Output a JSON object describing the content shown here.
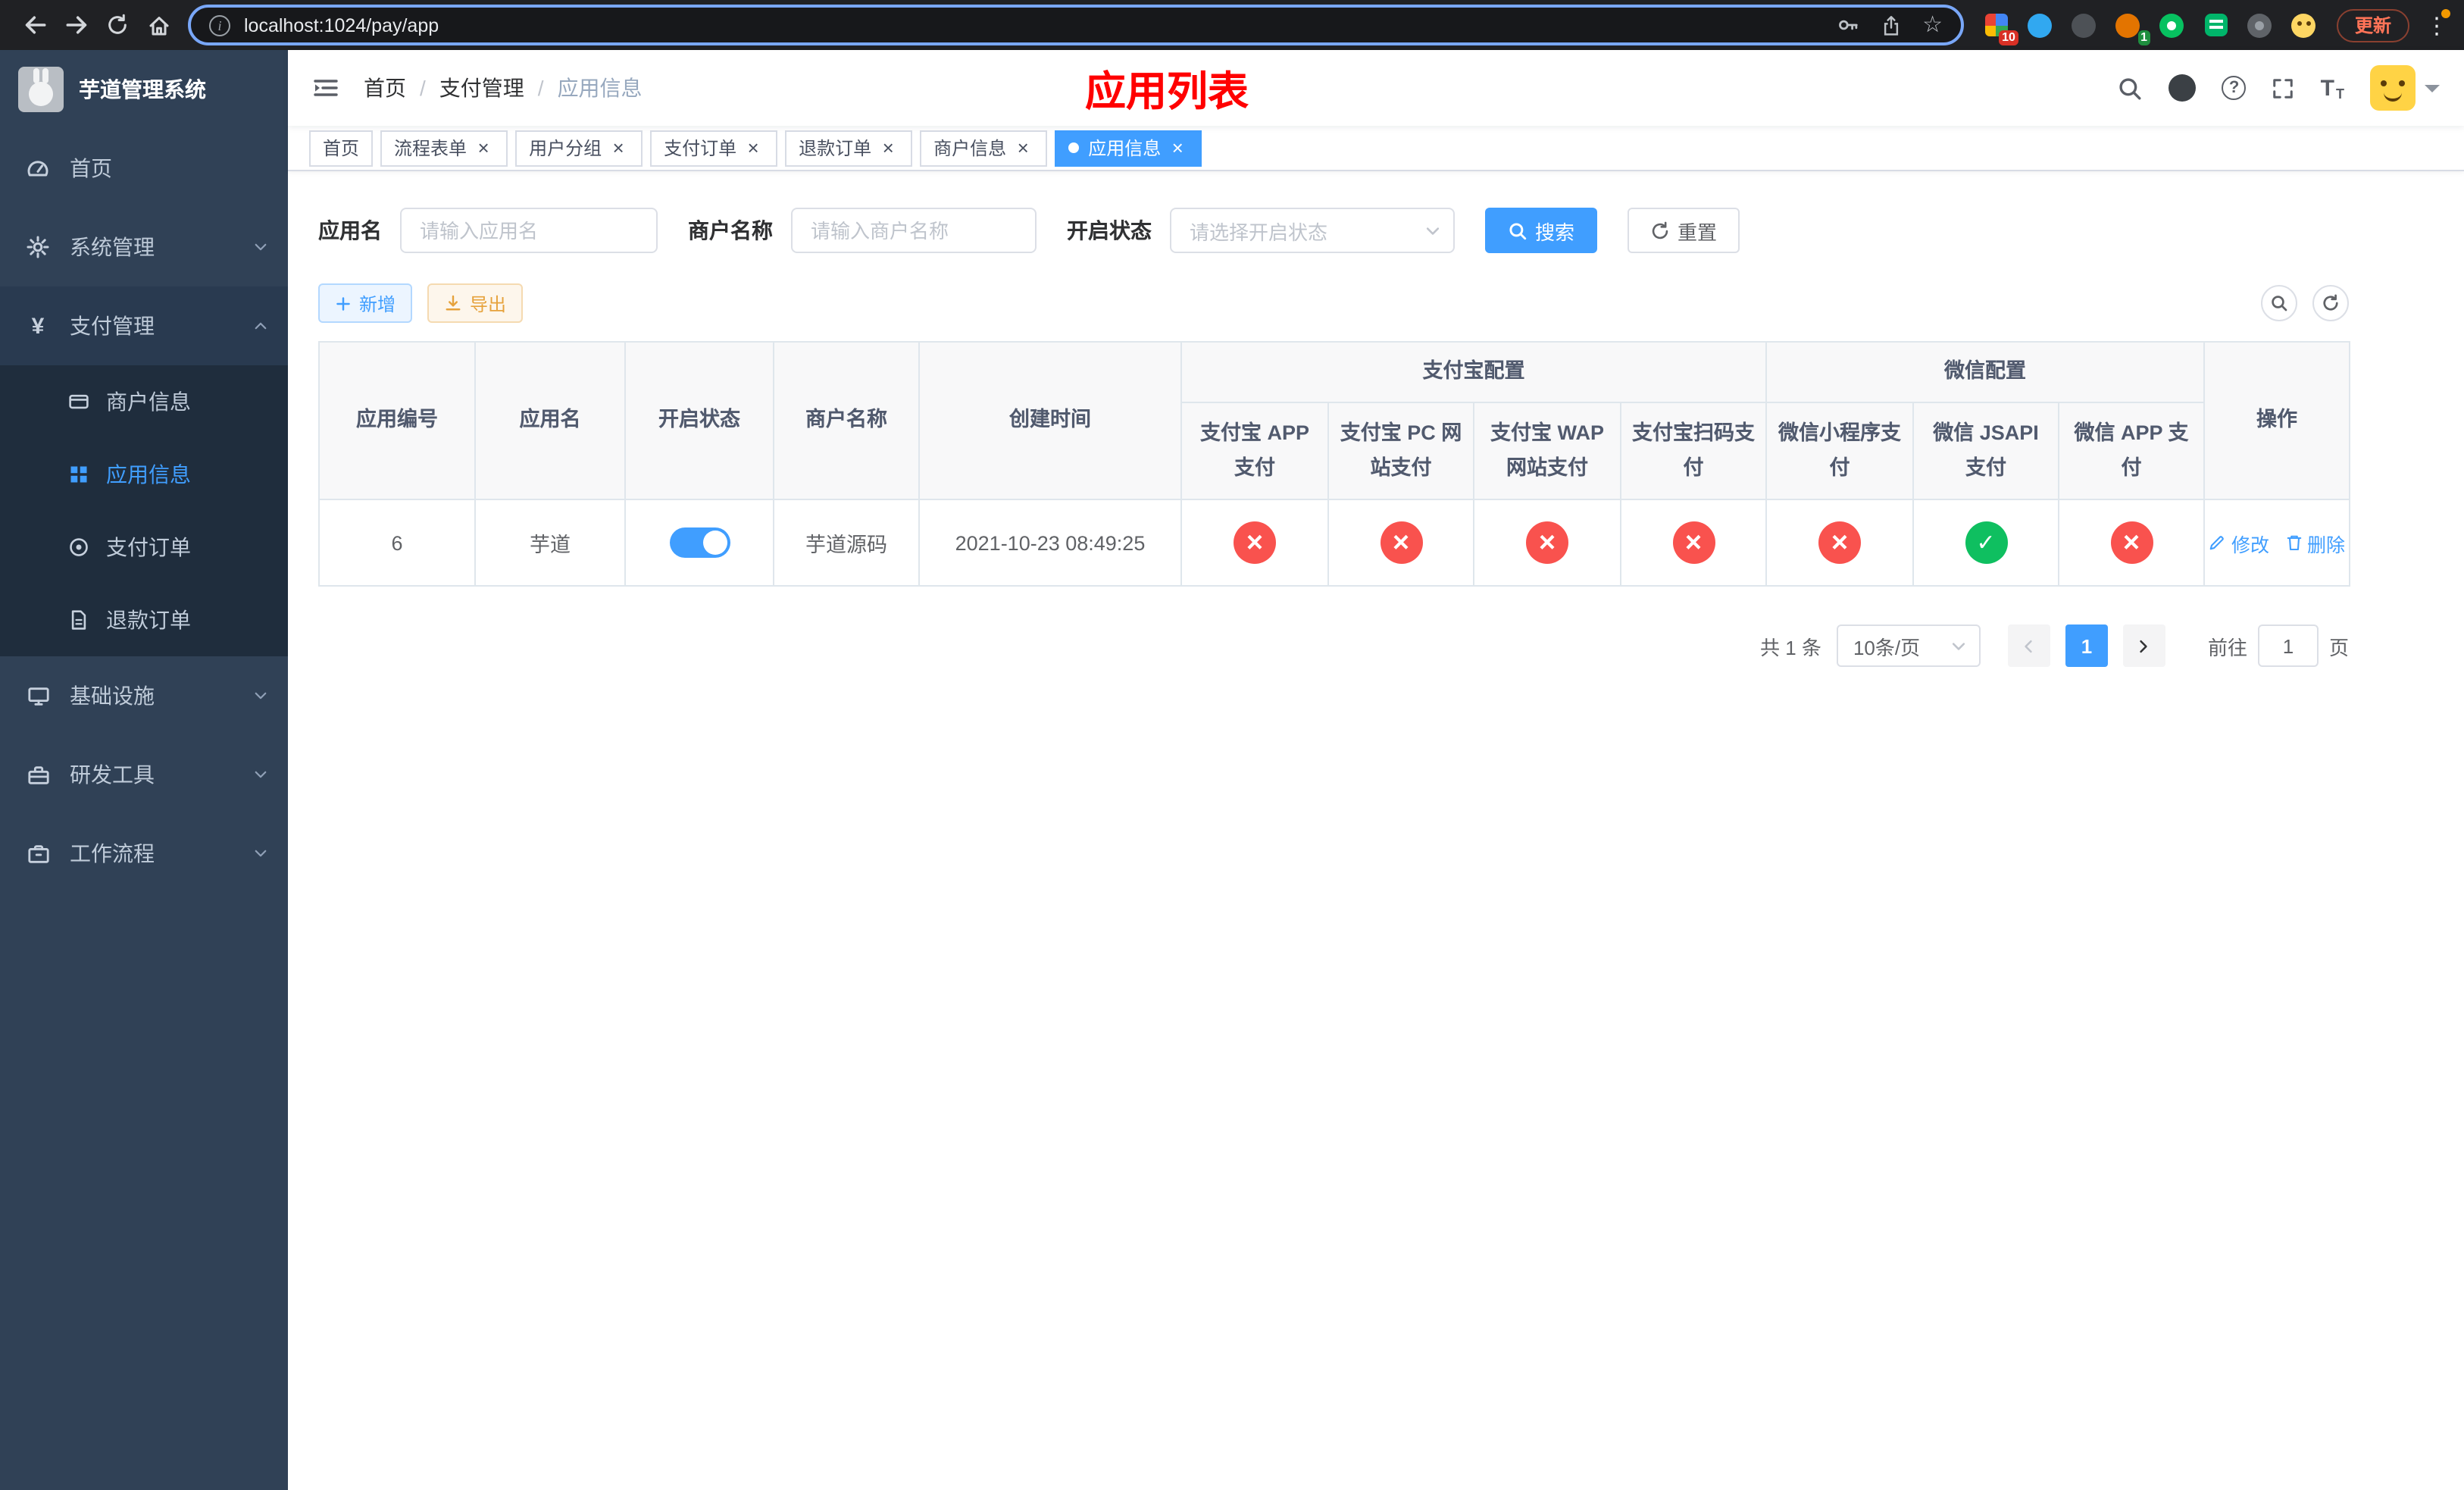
{
  "browser": {
    "url": "localhost:1024/pay/app",
    "update_label": "更新",
    "ext_badge_a": "10",
    "ext_badge_b": "1"
  },
  "sidebar": {
    "title": "芋道管理系统",
    "home": "首页",
    "system": "系统管理",
    "payment": "支付管理",
    "merchant_info": "商户信息",
    "app_info": "应用信息",
    "pay_order": "支付订单",
    "refund_order": "退款订单",
    "infra": "基础设施",
    "dev_tools": "研发工具",
    "workflow": "工作流程"
  },
  "breadcrumb": {
    "home": "首页",
    "payment": "支付管理",
    "current": "应用信息"
  },
  "page_title": "应用列表",
  "tabs": {
    "home": "首页",
    "flow_form": "流程表单",
    "user_group": "用户分组",
    "pay_order": "支付订单",
    "refund_order": "退款订单",
    "merchant_info": "商户信息",
    "app_info": "应用信息"
  },
  "filters": {
    "app_name_label": "应用名",
    "app_name_placeholder": "请输入应用名",
    "merchant_label": "商户名称",
    "merchant_placeholder": "请输入商户名称",
    "status_label": "开启状态",
    "status_placeholder": "请选择开启状态",
    "search_label": "搜索",
    "reset_label": "重置"
  },
  "toolbar": {
    "add_label": "新增",
    "export_label": "导出"
  },
  "table": {
    "col_id": "应用编号",
    "col_name": "应用名",
    "col_status": "开启状态",
    "col_merchant": "商户名称",
    "col_created": "创建时间",
    "group_alipay": "支付宝配置",
    "group_wechat": "微信配置",
    "col_alipay_app": "支付宝 APP 支付",
    "col_alipay_pc": "支付宝 PC 网站支付",
    "col_alipay_wap": "支付宝 WAP 网站支付",
    "col_alipay_qr": "支付宝扫码支付",
    "col_wx_mini": "微信小程序支付",
    "col_wx_jsapi": "微信 JSAPI 支付",
    "col_wx_app": "微信 APP 支付",
    "col_actions": "操作",
    "row": {
      "id": "6",
      "name": "芋道",
      "enabled": true,
      "merchant": "芋道源码",
      "created": "2021-10-23 08:49:25",
      "alipay_app": false,
      "alipay_pc": false,
      "alipay_wap": false,
      "alipay_qr": false,
      "wx_mini": false,
      "wx_jsapi": true,
      "wx_app": false,
      "edit_label": "修改",
      "delete_label": "删除"
    }
  },
  "pagination": {
    "total": "共 1 条",
    "page_size": "10条/页",
    "page": "1",
    "goto_label": "前往",
    "goto_value": "1",
    "goto_unit": "页"
  },
  "colors": {
    "accent": "#409eff",
    "success": "#0fbf60",
    "danger": "#f9524e",
    "title_red": "#ff0000",
    "sidebar_bg": "#304156",
    "submenu_bg": "#1f2d3d"
  }
}
